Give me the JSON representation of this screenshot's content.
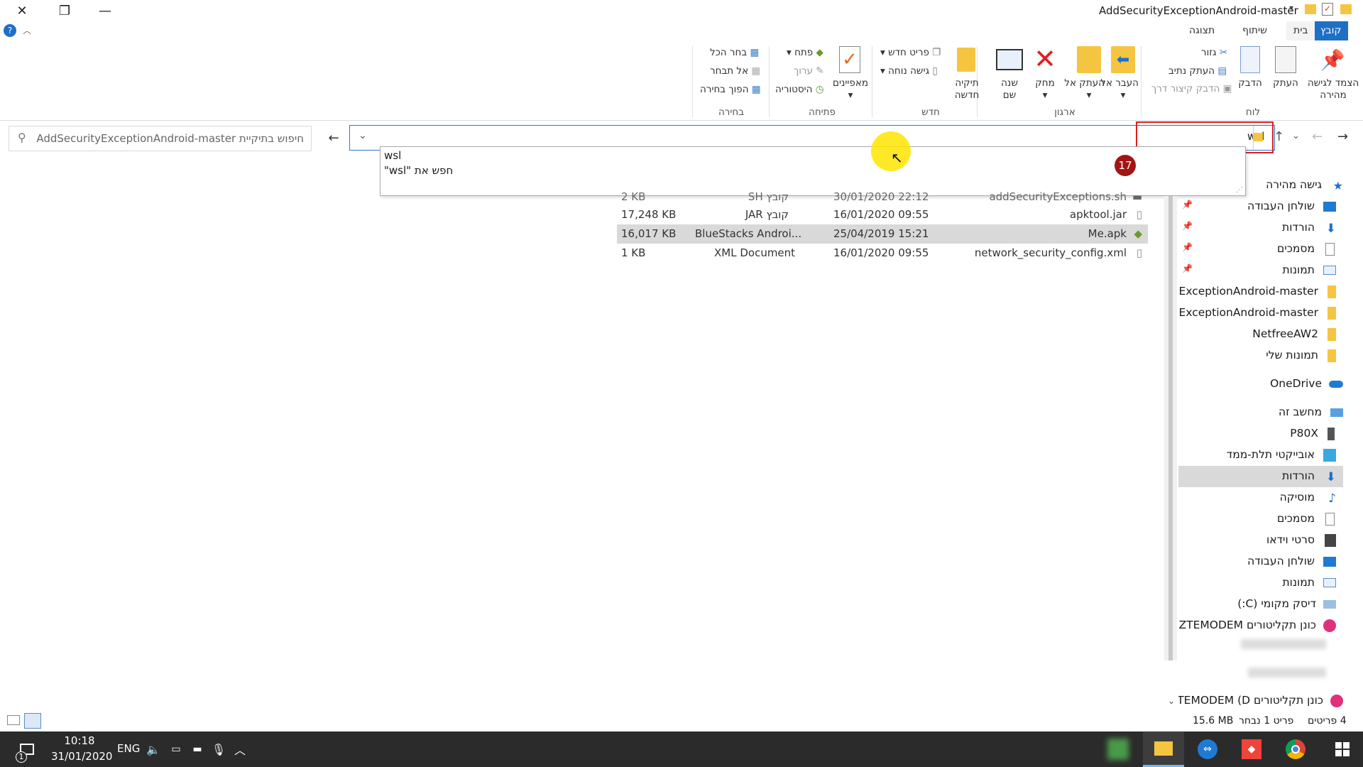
{
  "window": {
    "title": "AddSecurityExceptionAndroid-master",
    "tabs": [
      "קובץ",
      "בית",
      "שיתוף",
      "תצוגה"
    ]
  },
  "ribbon": {
    "clipboard": {
      "pin": "הצמד לגישה מהירה",
      "copy": "העתק",
      "paste": "הדבק",
      "cut": "גזור",
      "copy_path": "העתק נתיב",
      "paste_shortcut": "הדבק קיצור דרך",
      "group": "לוח"
    },
    "organize": {
      "move_to": "העבר אל",
      "copy_to": "העתק אל",
      "delete": "מחק",
      "rename": "שנה שם",
      "group": "ארגון"
    },
    "new": {
      "new_folder": "תיקיה חדשה",
      "new_item": "פריט חדש",
      "easy_access": "גישה נוחה",
      "group": "חדש"
    },
    "open": {
      "properties": "מאפיינים",
      "open": "פתח",
      "edit": "ערוך",
      "history": "היסטוריה",
      "group": "פתיחה"
    },
    "select": {
      "select_all": "בחר הכל",
      "select_none": "אל תבחר",
      "invert": "הפוך בחירה",
      "group": "בחירה"
    }
  },
  "address": {
    "value": "wsl",
    "search_placeholder": "חיפוש בתיקיית AddSecurityExceptionAndroid-master"
  },
  "suggest": {
    "item1": "wsl",
    "item2": "חפש את \"wsl\""
  },
  "step_badge": "17",
  "files": [
    {
      "name": "addSecurityExceptions.sh",
      "date": "30/01/2020 22:12",
      "type": "קובץ SH",
      "size": "2 KB"
    },
    {
      "name": "apktool.jar",
      "date": "16/01/2020 09:55",
      "type": "קובץ JAR",
      "size": "17,248 KB"
    },
    {
      "name": "Me.apk",
      "date": "25/04/2019 15:21",
      "type": "BlueStacks Androi...",
      "size": "16,017 KB"
    },
    {
      "name": "network_security_config.xml",
      "date": "16/01/2020 09:55",
      "type": "XML Document",
      "size": "1 KB"
    }
  ],
  "nav": {
    "quick_access": "גישה מהירה",
    "desktop": "שולחן העבודה",
    "downloads": "הורדות",
    "documents": "מסמכים",
    "pictures": "תמונות",
    "folder1": "AddSecurityExceptionAndroid-master",
    "folder2": "AddSecurityExceptionAndroid-master",
    "netfree": "NetfreeAW2",
    "my_pictures": "תמונות שלי",
    "onedrive": "OneDrive",
    "this_pc": "מחשב זה",
    "p80x": "P80X",
    "objects3d": "אובייקטי תלת-ממד",
    "downloads2": "הורדות",
    "music": "מוסיקה",
    "documents2": "מסמכים",
    "videos": "סרטי וידאו",
    "desktop2": "שולחן העבודה",
    "pictures2": "תמונות",
    "local_disk": "דיסק מקומי (C:)",
    "ztemodem1": "כונן תקליטורים ZTEMODEM (:",
    "ztemodem2": "כונן תקליטורים ZTEMODEM (D:"
  },
  "status": {
    "items": "4 פריטים",
    "selected": "פריט 1 נבחר",
    "size": "15.6 MB"
  },
  "taskbar": {
    "time": "10:18",
    "date": "31/01/2020",
    "lang": "ENG",
    "notif": "1"
  },
  "colors": {
    "accent": "#1f6fc5",
    "highlight": "#ffe500",
    "annotation": "#e01e1e",
    "badge": "#a31515"
  }
}
